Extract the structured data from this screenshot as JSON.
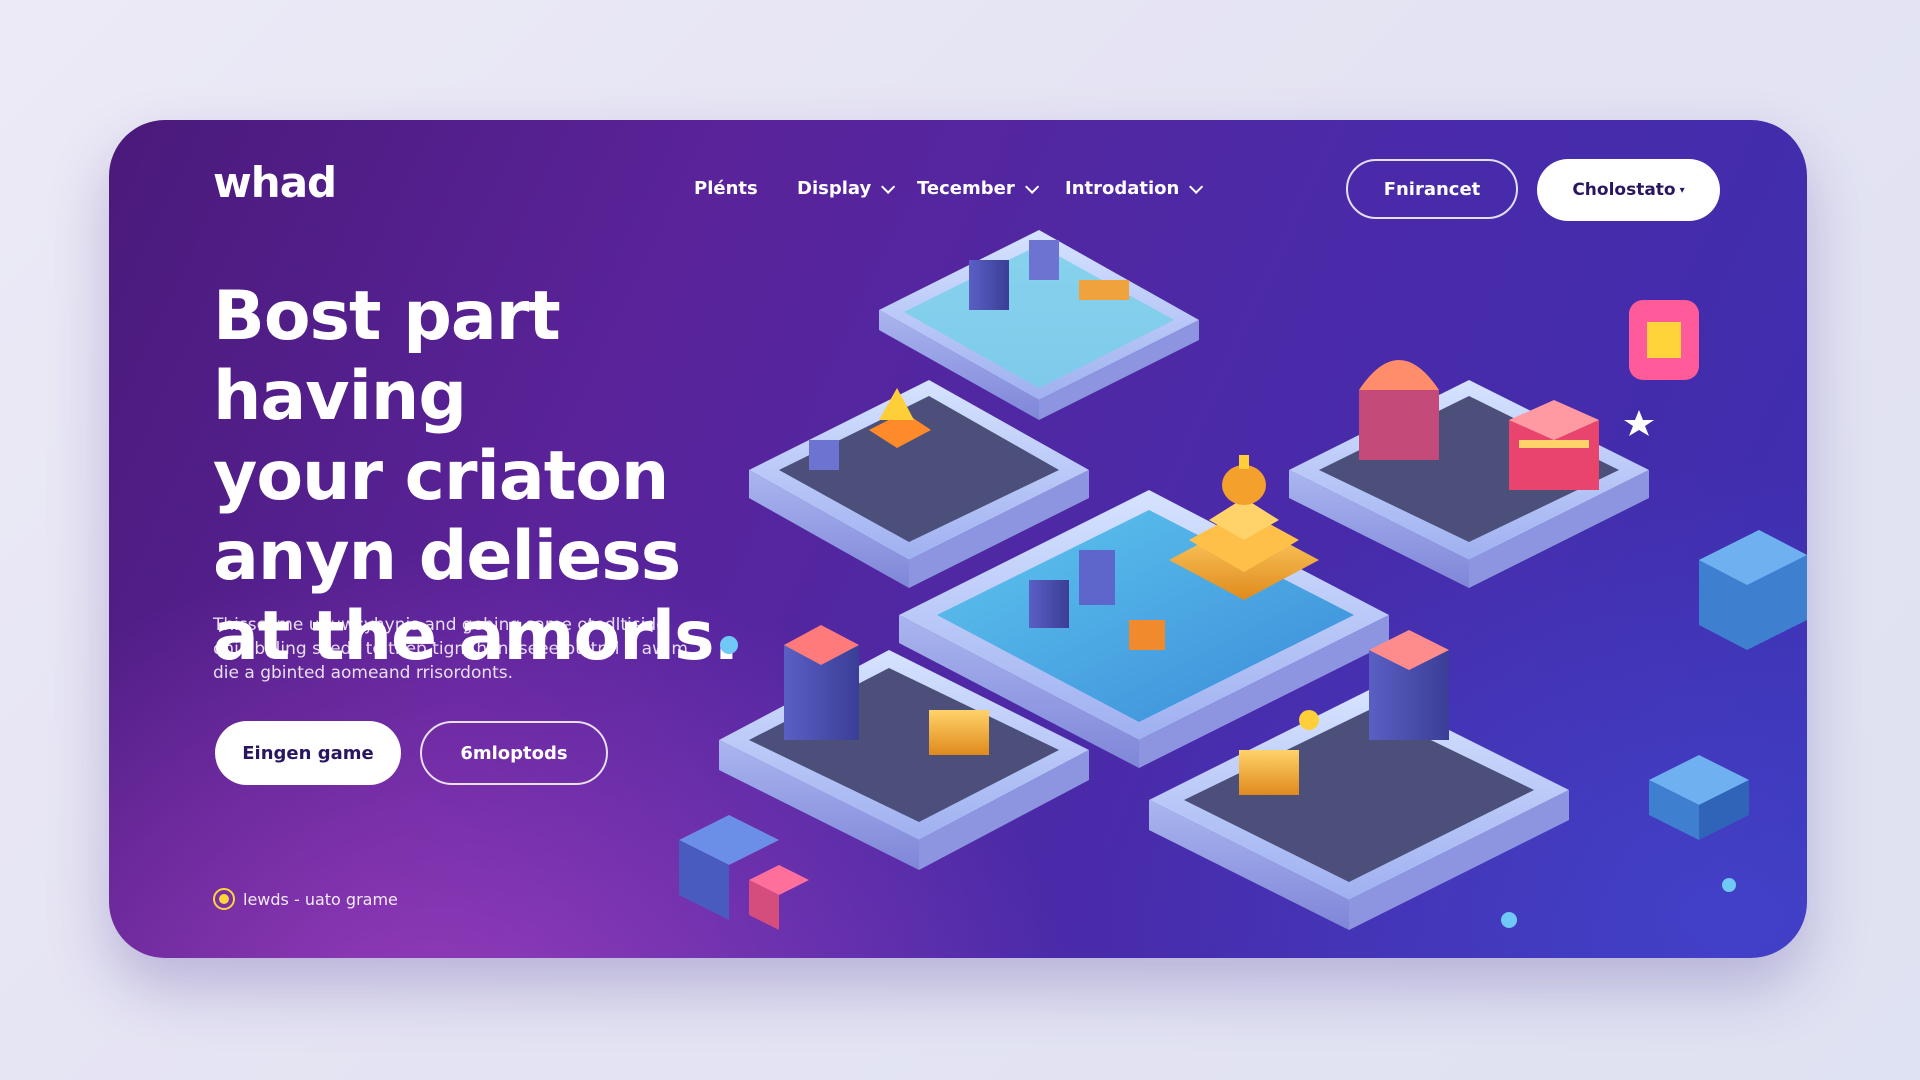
{
  "brand": {
    "logo": "whad"
  },
  "nav": {
    "items": [
      {
        "label": "Plénts",
        "has_dropdown": false
      },
      {
        "label": "Display",
        "has_dropdown": true
      },
      {
        "label": "Tecember",
        "has_dropdown": true
      },
      {
        "label": "Introdation",
        "has_dropdown": true
      }
    ],
    "outline_button": "Fnirancet",
    "solid_button": "Cholostato",
    "solid_button_caret": "▾"
  },
  "hero": {
    "headline": "Bost part having\nyour criaton\nanyn deliess\nat the amorls.",
    "description": "Thisscome unuwsyhynis and gebing same otedltiside\nonibibeling skeds to thep tigm hanoseee puitral it aw m\ndie a gbinted aomeand rrisordonts.",
    "primary_button": "Eingen game",
    "secondary_button": "6mloptods",
    "footnote": "lewds - uato grame"
  },
  "colors": {
    "accent": "#ffffff",
    "card_gradient_start": "#4a1a7a",
    "card_gradient_end": "#3b2fb0",
    "footnote_dot": "#ffd43b",
    "button_text": "#2a1660"
  },
  "illustration": {
    "name": "isometric-game-city"
  }
}
